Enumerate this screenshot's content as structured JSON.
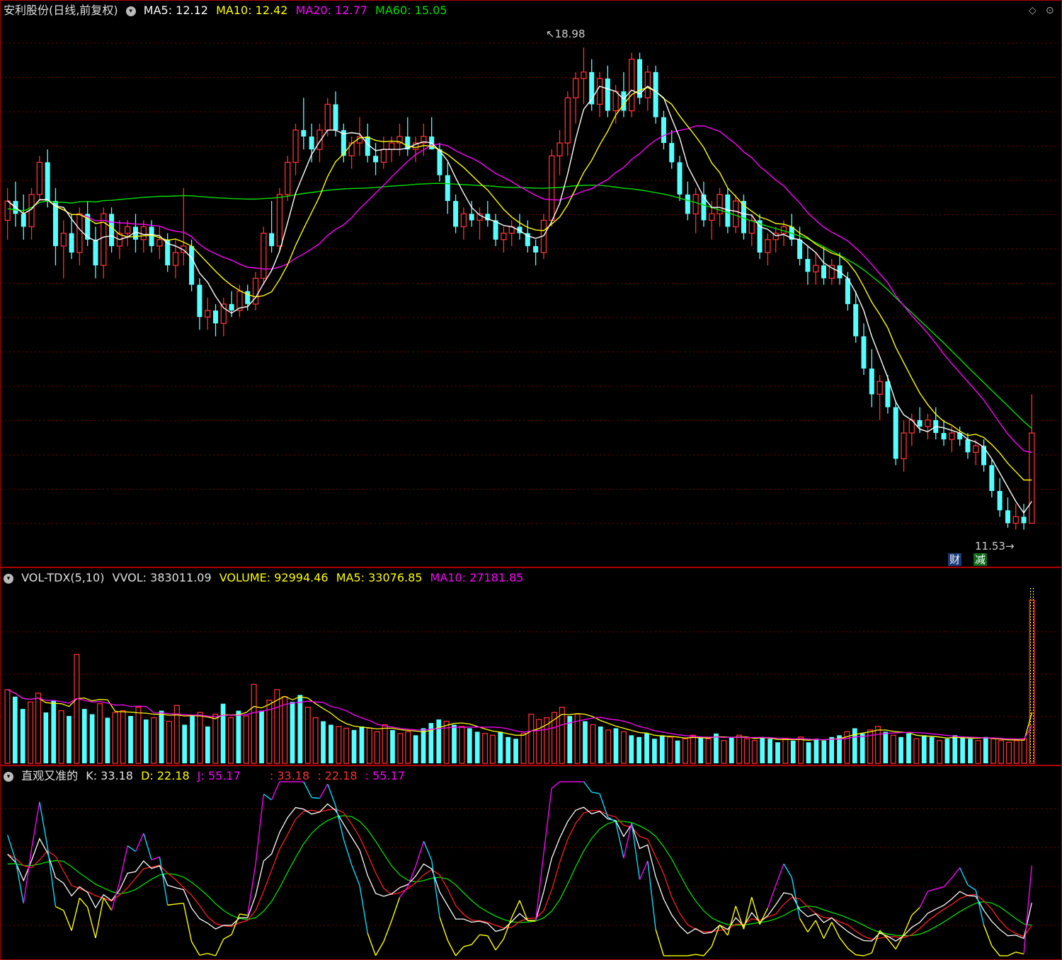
{
  "price_panel": {
    "title": "安利股份(日线,前复权)",
    "ma5": "MA5: 12.12",
    "ma10": "MA10: 12.42",
    "ma20": "MA20: 12.77",
    "ma60": "MA60: 15.05",
    "high_label": "18.98",
    "low_label": "11.53",
    "badge_cai": "财",
    "badge_jian": "减"
  },
  "vol_panel": {
    "title": "VOL-TDX(5,10)",
    "vvol": "VVOL: 383011.09",
    "volume": "VOLUME: 92994.46",
    "ma5": "MA5: 33076.85",
    "ma10": "MA10: 27181.85"
  },
  "kdj_panel": {
    "title": "直观又准的",
    "k": "K: 33.18",
    "d": "D: 22.18",
    "j": "J: 55.17",
    "v1": ": 33.18",
    "v2": ": 22.18",
    "v3": ": 55.17"
  },
  "colors": {
    "up": "#ff3030",
    "down": "#54ffff",
    "ma5": "#ffffff",
    "ma10": "#ffff00",
    "ma20": "#ff00ff",
    "ma60": "#00e000",
    "grid": "#7a0000"
  },
  "chart_data": [
    {
      "type": "candlestick",
      "title": "安利股份(日线,前复权)",
      "yrange": [
        11.2,
        19.4
      ],
      "series_ma": {
        "MA5": 12.12,
        "MA10": 12.42,
        "MA20": 12.77,
        "MA60": 15.05
      },
      "ohlc": [
        [
          16.3,
          16.8,
          16.0,
          16.6
        ],
        [
          16.6,
          16.9,
          16.2,
          16.4
        ],
        [
          16.4,
          16.7,
          16.0,
          16.2
        ],
        [
          16.2,
          16.8,
          16.0,
          16.7
        ],
        [
          16.7,
          17.3,
          16.6,
          17.2
        ],
        [
          17.2,
          17.4,
          16.5,
          16.6
        ],
        [
          16.6,
          16.8,
          15.6,
          15.9
        ],
        [
          15.9,
          16.3,
          15.4,
          16.1
        ],
        [
          16.1,
          16.4,
          15.7,
          15.8
        ],
        [
          15.8,
          16.5,
          15.6,
          16.4
        ],
        [
          16.4,
          16.6,
          15.9,
          16.0
        ],
        [
          16.0,
          16.2,
          15.4,
          15.6
        ],
        [
          15.6,
          16.5,
          15.4,
          16.4
        ],
        [
          16.4,
          16.5,
          15.8,
          15.9
        ],
        [
          15.9,
          16.3,
          15.7,
          16.1
        ],
        [
          16.1,
          16.3,
          15.9,
          16.2
        ],
        [
          16.2,
          16.4,
          15.8,
          16.0
        ],
        [
          16.0,
          16.3,
          15.8,
          16.2
        ],
        [
          16.2,
          16.3,
          15.8,
          15.9
        ],
        [
          15.9,
          16.2,
          15.7,
          16.0
        ],
        [
          16.0,
          16.1,
          15.5,
          15.6
        ],
        [
          15.6,
          16.0,
          15.4,
          15.8
        ],
        [
          15.8,
          16.8,
          15.6,
          15.9
        ],
        [
          15.9,
          16.0,
          15.2,
          15.3
        ],
        [
          15.3,
          15.4,
          14.6,
          14.8
        ],
        [
          14.8,
          15.1,
          14.6,
          14.9
        ],
        [
          14.9,
          15.0,
          14.5,
          14.7
        ],
        [
          14.7,
          15.1,
          14.5,
          15.0
        ],
        [
          15.0,
          15.2,
          14.8,
          14.9
        ],
        [
          14.9,
          15.3,
          14.8,
          15.2
        ],
        [
          15.2,
          15.3,
          14.9,
          15.0
        ],
        [
          15.0,
          15.5,
          14.9,
          15.4
        ],
        [
          15.4,
          16.2,
          15.3,
          16.1
        ],
        [
          16.1,
          16.6,
          15.8,
          15.9
        ],
        [
          15.9,
          16.8,
          15.8,
          16.7
        ],
        [
          16.7,
          17.3,
          16.6,
          17.2
        ],
        [
          17.2,
          17.8,
          17.0,
          17.7
        ],
        [
          17.7,
          18.2,
          17.4,
          17.6
        ],
        [
          17.6,
          17.8,
          17.2,
          17.4
        ],
        [
          17.4,
          17.8,
          17.2,
          17.7
        ],
        [
          17.7,
          18.2,
          17.6,
          18.1
        ],
        [
          18.1,
          18.3,
          17.6,
          17.7
        ],
        [
          17.7,
          17.8,
          17.2,
          17.3
        ],
        [
          17.3,
          17.6,
          17.1,
          17.5
        ],
        [
          17.5,
          17.9,
          17.3,
          17.6
        ],
        [
          17.6,
          17.8,
          17.2,
          17.3
        ],
        [
          17.3,
          17.5,
          17.0,
          17.2
        ],
        [
          17.2,
          17.6,
          17.1,
          17.4
        ],
        [
          17.4,
          17.6,
          17.2,
          17.5
        ],
        [
          17.5,
          17.8,
          17.3,
          17.6
        ],
        [
          17.6,
          17.9,
          17.3,
          17.4
        ],
        [
          17.4,
          17.6,
          17.2,
          17.5
        ],
        [
          17.5,
          17.8,
          17.3,
          17.6
        ],
        [
          17.6,
          17.9,
          17.4,
          17.4
        ],
        [
          17.4,
          17.5,
          16.9,
          17.0
        ],
        [
          17.0,
          17.2,
          16.4,
          16.6
        ],
        [
          16.6,
          16.7,
          16.1,
          16.2
        ],
        [
          16.2,
          16.5,
          16.0,
          16.4
        ],
        [
          16.4,
          16.6,
          16.2,
          16.3
        ],
        [
          16.3,
          16.5,
          16.0,
          16.4
        ],
        [
          16.4,
          16.6,
          16.2,
          16.3
        ],
        [
          16.3,
          16.4,
          15.9,
          16.0
        ],
        [
          16.0,
          16.2,
          15.8,
          16.1
        ],
        [
          16.1,
          16.3,
          15.9,
          16.2
        ],
        [
          16.2,
          16.4,
          16.0,
          16.1
        ],
        [
          16.1,
          16.3,
          15.8,
          15.9
        ],
        [
          15.9,
          16.0,
          15.6,
          15.8
        ],
        [
          15.8,
          16.4,
          15.7,
          16.3
        ],
        [
          16.3,
          17.4,
          16.2,
          17.3
        ],
        [
          17.3,
          17.7,
          17.0,
          17.5
        ],
        [
          17.5,
          18.3,
          17.3,
          18.2
        ],
        [
          18.2,
          18.6,
          17.8,
          18.5
        ],
        [
          18.5,
          18.98,
          18.1,
          18.6
        ],
        [
          18.6,
          18.8,
          18.0,
          18.1
        ],
        [
          18.1,
          18.6,
          17.9,
          18.5
        ],
        [
          18.5,
          18.7,
          17.9,
          18.0
        ],
        [
          18.0,
          18.4,
          17.8,
          18.3
        ],
        [
          18.3,
          18.6,
          17.9,
          18.0
        ],
        [
          18.0,
          18.9,
          17.9,
          18.8
        ],
        [
          18.8,
          18.9,
          18.1,
          18.2
        ],
        [
          18.2,
          18.7,
          18.0,
          18.6
        ],
        [
          18.6,
          18.7,
          17.8,
          17.9
        ],
        [
          17.9,
          18.0,
          17.4,
          17.5
        ],
        [
          17.5,
          17.7,
          17.1,
          17.2
        ],
        [
          17.2,
          17.3,
          16.6,
          16.7
        ],
        [
          16.7,
          16.9,
          16.3,
          16.4
        ],
        [
          16.4,
          16.8,
          16.1,
          16.7
        ],
        [
          16.7,
          16.9,
          16.2,
          16.3
        ],
        [
          16.3,
          16.6,
          16.0,
          16.4
        ],
        [
          16.4,
          16.8,
          16.2,
          16.7
        ],
        [
          16.7,
          16.8,
          16.1,
          16.2
        ],
        [
          16.2,
          16.7,
          16.1,
          16.6
        ],
        [
          16.6,
          16.7,
          16.0,
          16.1
        ],
        [
          16.1,
          16.4,
          15.9,
          16.3
        ],
        [
          16.3,
          16.4,
          15.7,
          15.8
        ],
        [
          15.8,
          16.1,
          15.6,
          16.0
        ],
        [
          16.0,
          16.2,
          15.8,
          16.1
        ],
        [
          16.1,
          16.3,
          15.9,
          16.2
        ],
        [
          16.2,
          16.4,
          15.9,
          16.0
        ],
        [
          16.0,
          16.2,
          15.6,
          15.7
        ],
        [
          15.7,
          15.9,
          15.3,
          15.5
        ],
        [
          15.5,
          15.8,
          15.3,
          15.6
        ],
        [
          15.6,
          15.9,
          15.3,
          15.4
        ],
        [
          15.4,
          15.7,
          15.3,
          15.6
        ],
        [
          15.6,
          15.8,
          15.3,
          15.4
        ],
        [
          15.4,
          15.5,
          14.9,
          15.0
        ],
        [
          15.0,
          15.2,
          14.4,
          14.5
        ],
        [
          14.5,
          14.7,
          13.9,
          14.0
        ],
        [
          14.0,
          14.3,
          13.4,
          13.6
        ],
        [
          13.6,
          13.9,
          13.2,
          13.8
        ],
        [
          13.8,
          13.9,
          13.3,
          13.4
        ],
        [
          13.4,
          13.5,
          12.5,
          12.6
        ],
        [
          12.6,
          13.2,
          12.4,
          13.0
        ],
        [
          13.0,
          13.3,
          12.8,
          13.2
        ],
        [
          13.2,
          13.4,
          13.0,
          13.1
        ],
        [
          13.1,
          13.3,
          12.9,
          13.2
        ],
        [
          13.2,
          13.4,
          12.9,
          13.0
        ],
        [
          13.0,
          13.2,
          12.8,
          12.9
        ],
        [
          12.9,
          13.1,
          12.7,
          13.0
        ],
        [
          13.0,
          13.1,
          12.8,
          12.9
        ],
        [
          12.9,
          13.0,
          12.6,
          12.7
        ],
        [
          12.7,
          12.9,
          12.5,
          12.8
        ],
        [
          12.8,
          12.9,
          12.4,
          12.5
        ],
        [
          12.5,
          12.6,
          12.0,
          12.1
        ],
        [
          12.1,
          12.3,
          11.7,
          11.8
        ],
        [
          11.8,
          12.0,
          11.53,
          11.6
        ],
        [
          11.6,
          11.9,
          11.5,
          11.7
        ],
        [
          11.7,
          11.9,
          11.5,
          11.6
        ],
        [
          11.6,
          13.6,
          11.6,
          13.0
        ]
      ]
    },
    {
      "type": "bar",
      "title": "VOL-TDX(5,10)",
      "values": [
        4.2,
        3.8,
        3.1,
        3.5,
        4.0,
        2.9,
        3.6,
        3.0,
        2.7,
        6.2,
        3.1,
        2.8,
        3.4,
        2.6,
        2.9,
        3.0,
        2.7,
        3.2,
        2.5,
        2.6,
        3.0,
        2.4,
        3.3,
        2.2,
        2.7,
        2.9,
        2.1,
        2.8,
        3.4,
        2.6,
        3.0,
        2.7,
        4.5,
        3.0,
        3.6,
        4.2,
        3.8,
        3.5,
        3.9,
        3.2,
        2.6,
        2.4,
        2.2,
        2.1,
        2.0,
        1.9,
        2.1,
        2.0,
        1.8,
        2.2,
        1.9,
        1.7,
        1.8,
        1.6,
        2.0,
        2.3,
        2.5,
        2.4,
        2.2,
        2.1,
        2.0,
        1.8,
        1.7,
        1.6,
        1.8,
        1.5,
        1.4,
        1.7,
        2.8,
        2.5,
        2.6,
        2.9,
        3.2,
        2.7,
        2.8,
        2.4,
        2.2,
        2.1,
        1.9,
        2.0,
        1.8,
        1.6,
        1.5,
        1.7,
        1.4,
        1.6,
        1.5,
        1.3,
        1.4,
        1.6,
        1.5,
        1.4,
        1.7,
        1.3,
        1.5,
        1.6,
        1.4,
        1.3,
        1.5,
        1.4,
        1.2,
        1.4,
        1.3,
        1.5,
        1.2,
        1.4,
        1.3,
        1.5,
        1.6,
        1.8,
        2.0,
        1.7,
        1.9,
        2.1,
        1.8,
        1.6,
        1.5,
        1.7,
        1.4,
        1.6,
        1.5,
        1.3,
        1.4,
        1.6,
        1.5,
        1.4,
        1.3,
        1.5,
        1.4,
        1.3,
        1.2,
        1.3,
        1.4,
        9.3
      ]
    },
    {
      "type": "line",
      "title": "直观又准的",
      "series": [
        {
          "name": "K",
          "values": [
            33.18
          ]
        },
        {
          "name": "D",
          "values": [
            22.18
          ]
        },
        {
          "name": "J",
          "values": [
            55.17
          ]
        }
      ],
      "ylim": [
        0,
        100
      ]
    }
  ]
}
